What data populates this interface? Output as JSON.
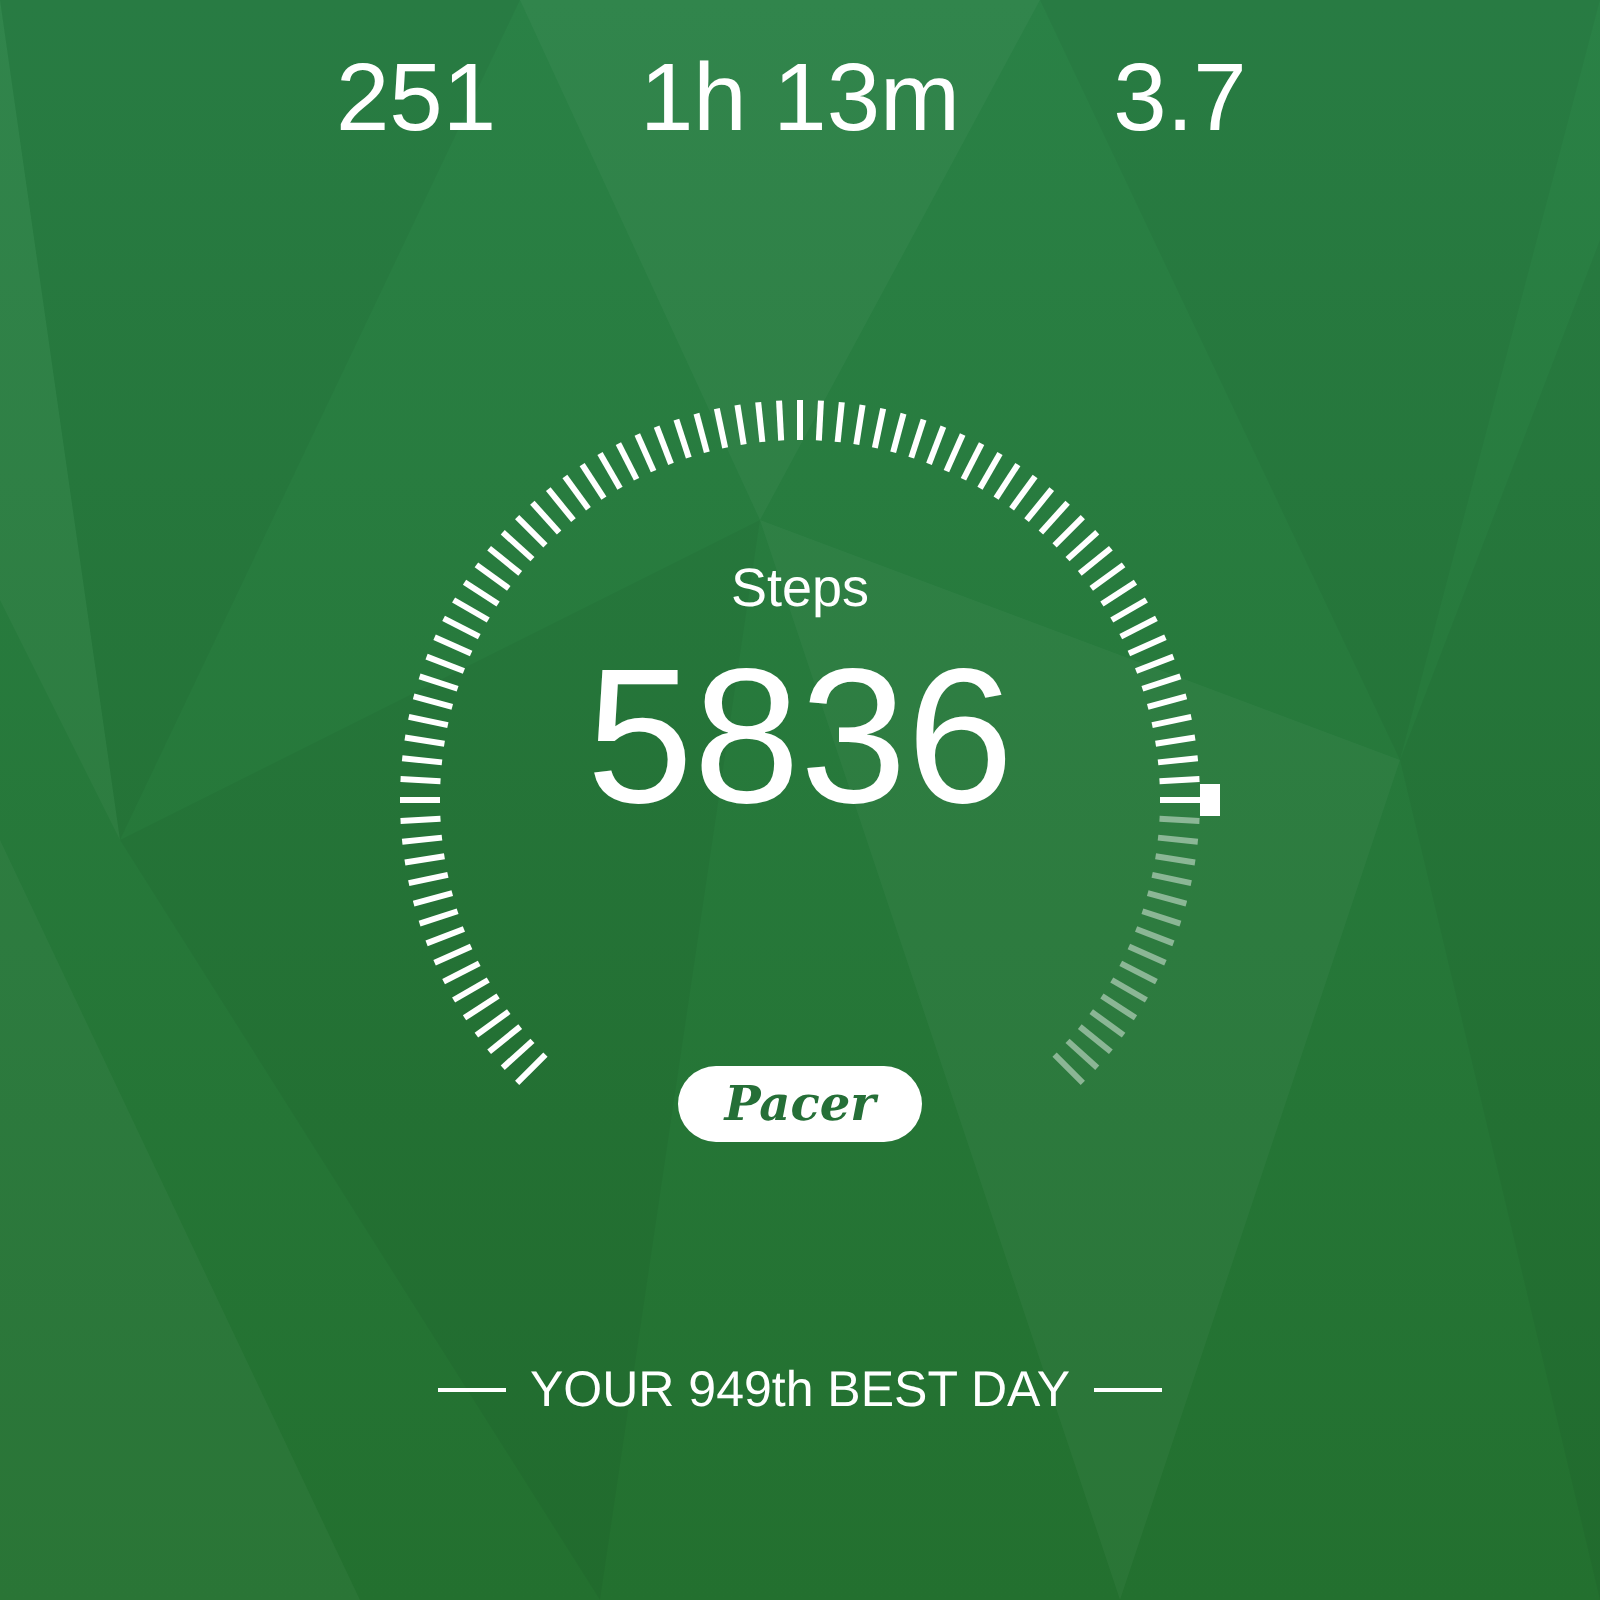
{
  "stats": [
    {
      "value": "251"
    },
    {
      "value": "1h 13m"
    },
    {
      "value": "3.7"
    }
  ],
  "gauge": {
    "label": "Steps",
    "value": "5836"
  },
  "brand": "Pacer",
  "best_day": "YOUR 949th BEST DAY"
}
